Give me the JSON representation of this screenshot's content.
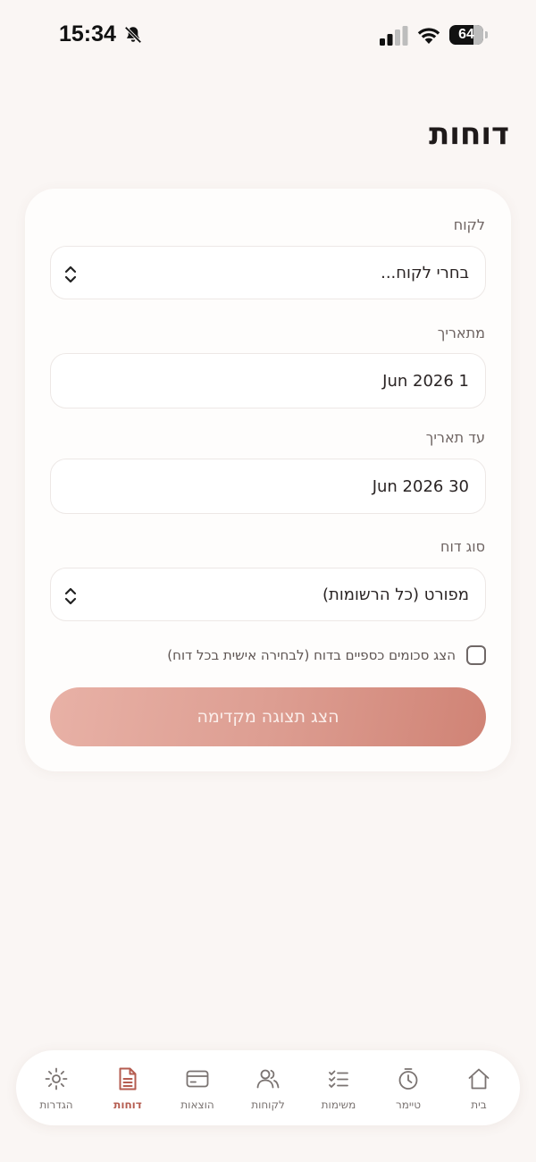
{
  "status_bar": {
    "time": "15:34",
    "battery": "64",
    "icons": [
      "bell-slash-icon",
      "signal-icon",
      "wifi-icon",
      "battery-icon"
    ]
  },
  "page": {
    "title": "דוחות"
  },
  "form": {
    "client": {
      "label": "לקוח",
      "value": "בחרי לקוח..."
    },
    "from_date": {
      "label": "מתאריך",
      "value": "1 Jun 2026"
    },
    "to_date": {
      "label": "עד תאריך",
      "value": "30 Jun 2026"
    },
    "report_type": {
      "label": "סוג דוח",
      "value": "מפורט (כל הרשומות)"
    },
    "show_amounts": {
      "label": "הצג סכומים כספיים בדוח (לבחירה אישית בכל דוח)",
      "checked": false
    },
    "submit_label": "הצג תצוגה מקדימה"
  },
  "tabs": [
    {
      "id": "home",
      "label": "בית",
      "icon": "home-icon"
    },
    {
      "id": "timer",
      "label": "טיימר",
      "icon": "stopwatch-icon"
    },
    {
      "id": "tasks",
      "label": "משימות",
      "icon": "checklist-icon"
    },
    {
      "id": "clients",
      "label": "לקוחות",
      "icon": "users-icon"
    },
    {
      "id": "expenses",
      "label": "הוצאות",
      "icon": "credit-card-icon"
    },
    {
      "id": "reports",
      "label": "דוחות",
      "icon": "document-icon",
      "active": true
    },
    {
      "id": "settings",
      "label": "הגדרות",
      "icon": "gear-icon"
    }
  ],
  "colors": {
    "background": "#faf6f4",
    "accent": "#b55c50",
    "button_gradient_start": "#e8b1a6",
    "button_gradient_end": "#d08375"
  }
}
